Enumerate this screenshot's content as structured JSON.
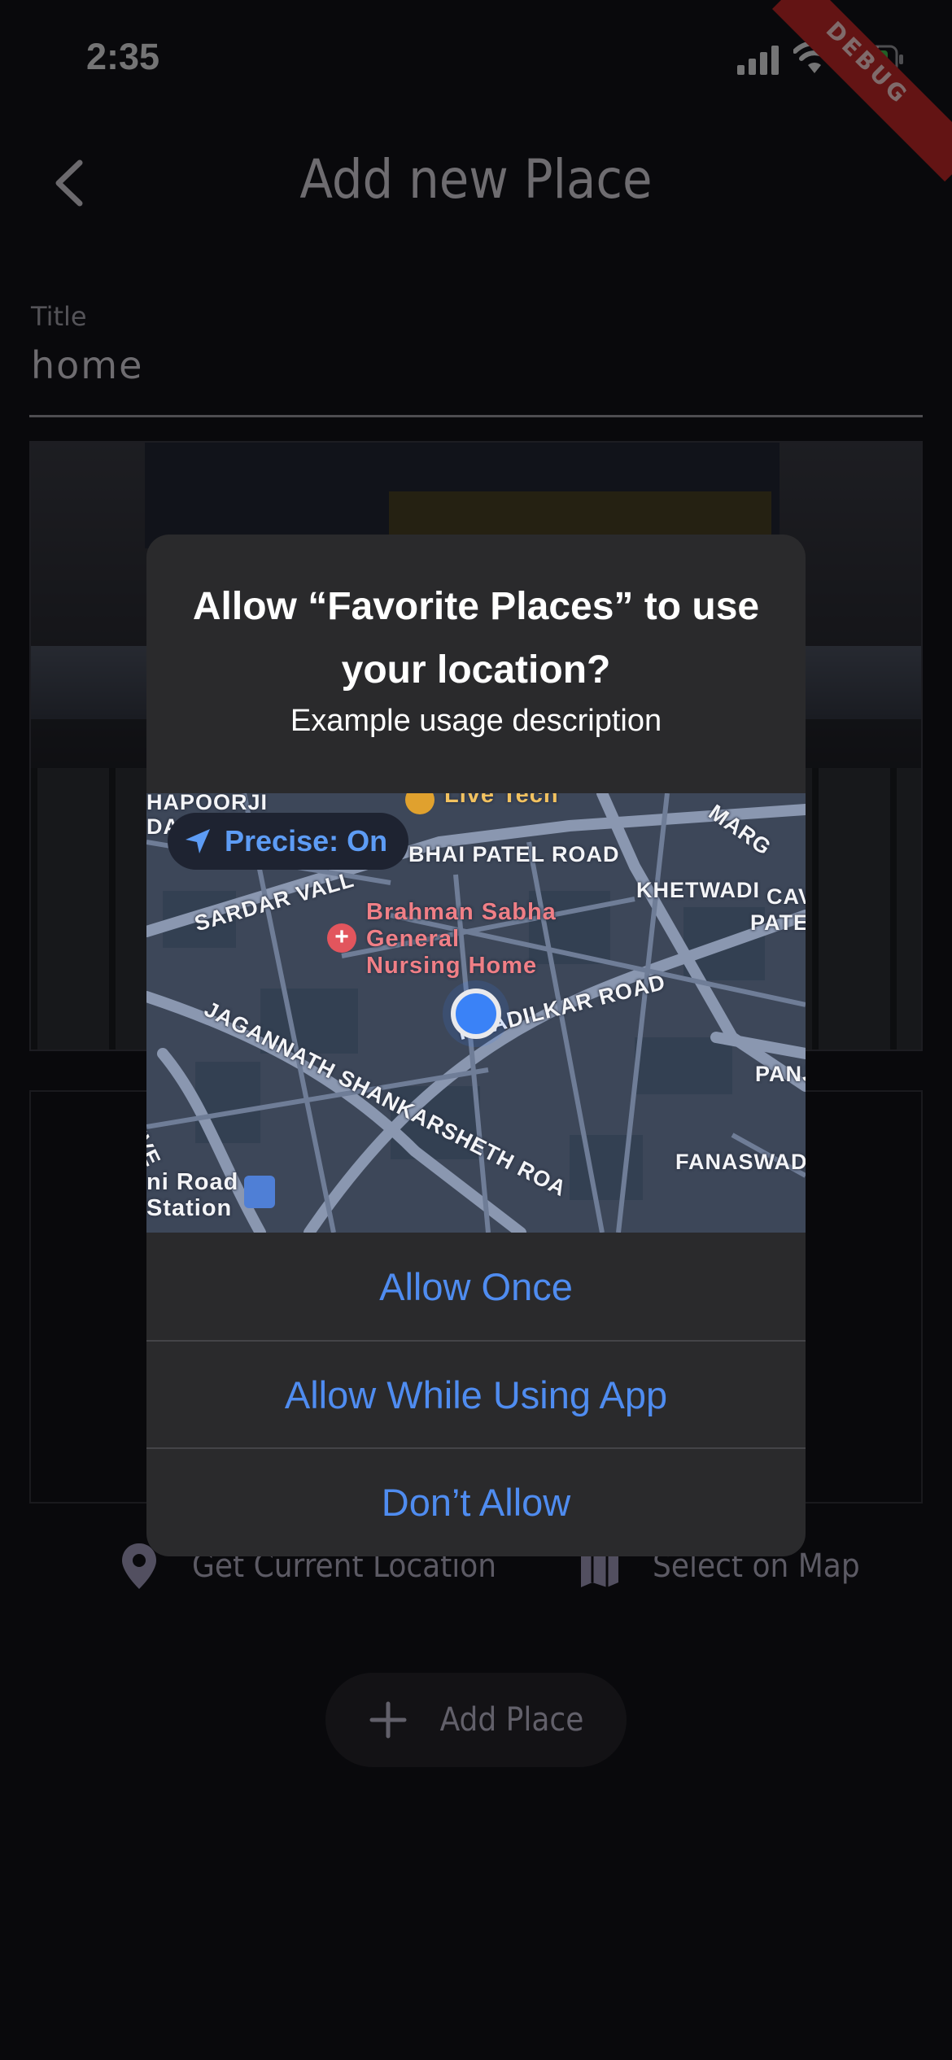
{
  "status_bar": {
    "time": "2:35",
    "debug_label": "DEBUG"
  },
  "app_bar": {
    "title": "Add new Place"
  },
  "form": {
    "title_label": "Title",
    "title_value": "home"
  },
  "location_actions": {
    "current_label": "Get Current Location",
    "map_label": "Select on Map"
  },
  "add_place": {
    "label": "Add Place"
  },
  "alert": {
    "title": "Allow “Favorite Places” to use your location?",
    "message": "Example usage description",
    "precise": "Precise: On",
    "map_labels": {
      "hapoorji": "HAPOORJI",
      "dad": "DAD",
      "livetech": "Live Tech",
      "marg": "MARG",
      "bhai_patel": "BHAI PATEL ROAD",
      "sardar": "SARDAR VALL",
      "khetwadi": "KHETWADI",
      "cav": "CAV",
      "patel": "PATEL",
      "hospital": "Brahman Sabha\nGeneral\nNursing Home",
      "jagannath": "JAGANNATH SHANKARSHETH ROA",
      "khadilkar": "KHADILKAR ROAD",
      "panj": "PANJ",
      "fanaswadi": "FANASWADI",
      "rive": "RIVE",
      "station": "ni Road\nStation"
    },
    "buttons": {
      "allow_once": "Allow Once",
      "allow_while": "Allow While Using App",
      "dont_allow": "Don’t Allow"
    }
  },
  "colors": {
    "background": "#121218",
    "alert_bg": "#2a2a2c",
    "ios_blue": "#4f8cf0",
    "debug_red": "#c62828",
    "accent_purple": "#b8b4c8"
  },
  "icons": [
    "back-icon",
    "signal-icon",
    "wifi-icon",
    "battery-icon",
    "location-pin-icon",
    "map-icon",
    "add-icon",
    "location-arrow-icon",
    "hospital-icon",
    "train-station-icon"
  ]
}
